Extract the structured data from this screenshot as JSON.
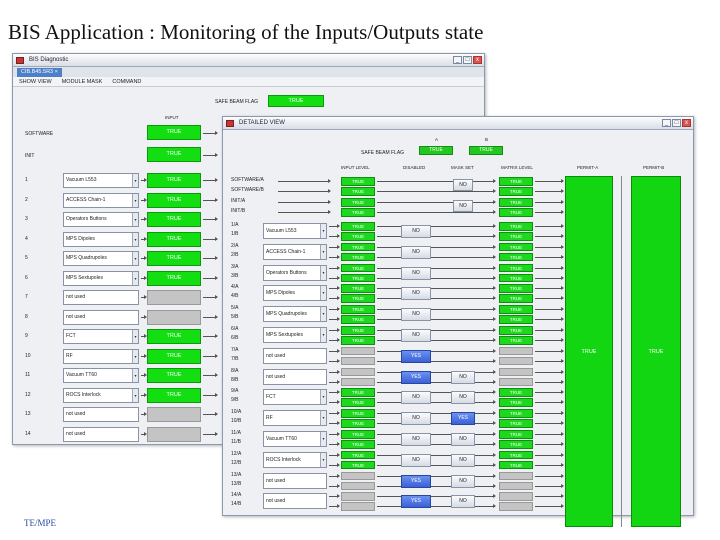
{
  "slide": {
    "title": "BIS Application : Monitoring of the Inputs/Outputs  state",
    "footer": "TE/MPE"
  },
  "back_window": {
    "title": "BIS Diagnostic",
    "tab": "CIB.B45.5R3",
    "menu": [
      "SHOW VIEW",
      "MODULE MASK",
      "COMMAND"
    ],
    "safe_beam_flag_label": "SAFE BEAM FLAG",
    "safe_beam_flag_value": "TRUE",
    "input_header": "INPUT",
    "software_label": "SOFTWARE",
    "init_label": "INIT",
    "software_value": "TRUE",
    "init_value": "TRUE",
    "rows": [
      {
        "num": "1",
        "name": "Vacuum L553",
        "value": "TRUE",
        "type": "combo"
      },
      {
        "num": "2",
        "name": "ACCESS Chain-1",
        "value": "TRUE",
        "type": "combo"
      },
      {
        "num": "3",
        "name": "Operators Buttons",
        "value": "TRUE",
        "type": "combo"
      },
      {
        "num": "4",
        "name": "MPS Dipoles",
        "value": "TRUE",
        "type": "combo"
      },
      {
        "num": "5",
        "name": "MPS Quadrupoles",
        "value": "TRUE",
        "type": "combo"
      },
      {
        "num": "6",
        "name": "MPS Sextupoles",
        "value": "TRUE",
        "type": "combo"
      },
      {
        "num": "7",
        "name": "not used",
        "value": "",
        "type": "text"
      },
      {
        "num": "8",
        "name": "not used",
        "value": "",
        "type": "text"
      },
      {
        "num": "9",
        "name": "FCT",
        "value": "TRUE",
        "type": "combo"
      },
      {
        "num": "10",
        "name": "RF",
        "value": "TRUE",
        "type": "combo"
      },
      {
        "num": "11",
        "name": "Vacuum TT60",
        "value": "TRUE",
        "type": "combo"
      },
      {
        "num": "12",
        "name": "ROCS Interlock",
        "value": "TRUE",
        "type": "combo"
      },
      {
        "num": "13",
        "name": "not used",
        "value": "",
        "type": "text"
      },
      {
        "num": "14",
        "name": "not used",
        "value": "",
        "type": "text"
      }
    ]
  },
  "front_window": {
    "title": "DETAILED VIEW",
    "safe_beam_flag_label": "SAFE BEAM FLAG",
    "flag_a_label": "A",
    "flag_b_label": "B",
    "flag_a_value": "TRUE",
    "flag_b_value": "TRUE",
    "headers": {
      "input_level": "INPUT LEVEL",
      "disabled": "DISABLED",
      "mask_set": "MASK SET",
      "matrix_level": "MATRIX LEVEL",
      "permit_a": "PERMIT-A",
      "permit_b": "PERMIT-B"
    },
    "permit_a_value": "TRUE",
    "permit_b_value": "TRUE",
    "special_rows": [
      {
        "label_a": "SOFTWARE/A",
        "label_b": "SOFTWARE/B",
        "level_a": "TRUE",
        "level_b": "TRUE",
        "mask": "NO",
        "matrix_a": "TRUE",
        "matrix_b": "TRUE"
      },
      {
        "label_a": "INIT/A",
        "label_b": "INIT/B",
        "level_a": "TRUE",
        "level_b": "TRUE",
        "mask": "NO",
        "matrix_a": "TRUE",
        "matrix_b": "TRUE"
      }
    ],
    "rows": [
      {
        "label_a": "1/A",
        "label_b": "1/B",
        "name": "Vacuum L553",
        "type": "combo",
        "level_a": "TRUE",
        "level_b": "TRUE",
        "disabled": "NO",
        "mask": "",
        "matrix_a": "TRUE",
        "matrix_b": "TRUE"
      },
      {
        "label_a": "2/A",
        "label_b": "2/B",
        "name": "ACCESS Chain-1",
        "type": "combo",
        "level_a": "TRUE",
        "level_b": "TRUE",
        "disabled": "NO",
        "mask": "",
        "matrix_a": "TRUE",
        "matrix_b": "TRUE"
      },
      {
        "label_a": "3/A",
        "label_b": "3/B",
        "name": "Operators Buttons",
        "type": "combo",
        "level_a": "TRUE",
        "level_b": "TRUE",
        "disabled": "NO",
        "mask": "",
        "matrix_a": "TRUE",
        "matrix_b": "TRUE"
      },
      {
        "label_a": "4/A",
        "label_b": "4/B",
        "name": "MPS Dipoles",
        "type": "combo",
        "level_a": "TRUE",
        "level_b": "TRUE",
        "disabled": "NO",
        "mask": "",
        "matrix_a": "TRUE",
        "matrix_b": "TRUE"
      },
      {
        "label_a": "5/A",
        "label_b": "5/B",
        "name": "MPS Quadrupoles",
        "type": "combo",
        "level_a": "TRUE",
        "level_b": "TRUE",
        "disabled": "NO",
        "mask": "",
        "matrix_a": "TRUE",
        "matrix_b": "TRUE"
      },
      {
        "label_a": "6/A",
        "label_b": "6/B",
        "name": "MPS Sextupoles",
        "type": "combo",
        "level_a": "TRUE",
        "level_b": "TRUE",
        "disabled": "NO",
        "mask": "",
        "matrix_a": "TRUE",
        "matrix_b": "TRUE"
      },
      {
        "label_a": "7/A",
        "label_b": "7/B",
        "name": "not used",
        "type": "text",
        "level_a": "",
        "level_b": "",
        "disabled": "YES",
        "mask": "",
        "matrix_a": "",
        "matrix_b": ""
      },
      {
        "label_a": "8/A",
        "label_b": "8/B",
        "name": "not used",
        "type": "text",
        "level_a": "",
        "level_b": "",
        "disabled": "YES",
        "mask": "NO",
        "matrix_a": "",
        "matrix_b": ""
      },
      {
        "label_a": "9/A",
        "label_b": "9/B",
        "name": "FCT",
        "type": "combo",
        "level_a": "TRUE",
        "level_b": "TRUE",
        "disabled": "NO",
        "mask": "NO",
        "matrix_a": "TRUE",
        "matrix_b": "TRUE"
      },
      {
        "label_a": "10/A",
        "label_b": "10/B",
        "name": "RF",
        "type": "combo",
        "level_a": "TRUE",
        "level_b": "TRUE",
        "disabled": "NO",
        "mask": "YES",
        "matrix_a": "TRUE",
        "matrix_b": "TRUE"
      },
      {
        "label_a": "11/A",
        "label_b": "11/B",
        "name": "Vacuum TT60",
        "type": "combo",
        "level_a": "TRUE",
        "level_b": "TRUE",
        "disabled": "NO",
        "mask": "NO",
        "matrix_a": "TRUE",
        "matrix_b": "TRUE"
      },
      {
        "label_a": "12/A",
        "label_b": "12/B",
        "name": "ROCS Interlock",
        "type": "combo",
        "level_a": "TRUE",
        "level_b": "TRUE",
        "disabled": "NO",
        "mask": "NO",
        "matrix_a": "TRUE",
        "matrix_b": "TRUE"
      },
      {
        "label_a": "13/A",
        "label_b": "13/B",
        "name": "not used",
        "type": "text",
        "level_a": "",
        "level_b": "",
        "disabled": "YES",
        "mask": "NO",
        "matrix_a": "",
        "matrix_b": ""
      },
      {
        "label_a": "14/A",
        "label_b": "14/B",
        "name": "not used",
        "type": "text",
        "level_a": "",
        "level_b": "",
        "disabled": "YES",
        "mask": "NO",
        "matrix_a": "",
        "matrix_b": ""
      }
    ]
  }
}
